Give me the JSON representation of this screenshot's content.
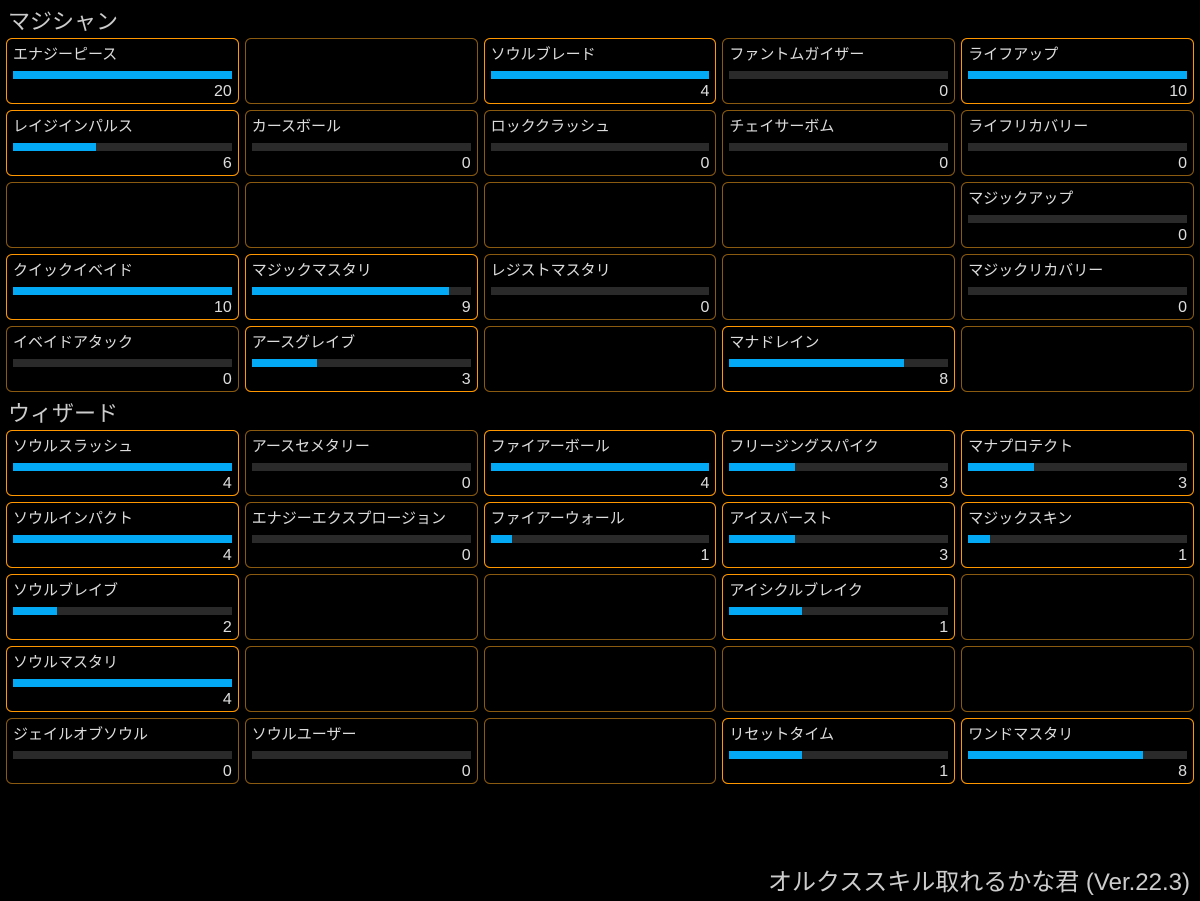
{
  "footer": "オルクススキル取れるかな君 (Ver.22.3)",
  "sections": [
    {
      "title": "マジシャン",
      "rows": [
        [
          {
            "name": "エナジーピース",
            "value": 20,
            "fill": 100,
            "bright": true
          },
          {
            "empty": true
          },
          {
            "name": "ソウルブレード",
            "value": 4,
            "fill": 100,
            "bright": true
          },
          {
            "name": "ファントムガイザー",
            "value": 0,
            "fill": 0,
            "bright": false
          },
          {
            "name": "ライフアップ",
            "value": 10,
            "fill": 100,
            "bright": true
          }
        ],
        [
          {
            "name": "レイジインパルス",
            "value": 6,
            "fill": 38,
            "bright": true
          },
          {
            "name": "カースボール",
            "value": 0,
            "fill": 0,
            "bright": false
          },
          {
            "name": "ロッククラッシュ",
            "value": 0,
            "fill": 0,
            "bright": false
          },
          {
            "name": "チェイサーボム",
            "value": 0,
            "fill": 0,
            "bright": false
          },
          {
            "name": "ライフリカバリー",
            "value": 0,
            "fill": 0,
            "bright": false
          }
        ],
        [
          {
            "empty": true
          },
          {
            "empty": true
          },
          {
            "empty": true
          },
          {
            "empty": true
          },
          {
            "name": "マジックアップ",
            "value": 0,
            "fill": 0,
            "bright": false
          }
        ],
        [
          {
            "name": "クイックイベイド",
            "value": 10,
            "fill": 100,
            "bright": true
          },
          {
            "name": "マジックマスタリ",
            "value": 9,
            "fill": 90,
            "bright": true
          },
          {
            "name": "レジストマスタリ",
            "value": 0,
            "fill": 0,
            "bright": false
          },
          {
            "empty": true
          },
          {
            "name": "マジックリカバリー",
            "value": 0,
            "fill": 0,
            "bright": false
          }
        ],
        [
          {
            "name": "イベイドアタック",
            "value": 0,
            "fill": 0,
            "bright": false
          },
          {
            "name": "アースグレイブ",
            "value": 3,
            "fill": 30,
            "bright": true
          },
          {
            "empty": true
          },
          {
            "name": "マナドレイン",
            "value": 8,
            "fill": 80,
            "bright": true
          },
          {
            "empty": true
          }
        ]
      ]
    },
    {
      "title": "ウィザード",
      "rows": [
        [
          {
            "name": "ソウルスラッシュ",
            "value": 4,
            "fill": 100,
            "bright": true
          },
          {
            "name": "アースセメタリー",
            "value": 0,
            "fill": 0,
            "bright": false
          },
          {
            "name": "ファイアーボール",
            "value": 4,
            "fill": 100,
            "bright": true
          },
          {
            "name": "フリージングスパイク",
            "value": 3,
            "fill": 30,
            "bright": true
          },
          {
            "name": "マナプロテクト",
            "value": 3,
            "fill": 30,
            "bright": true
          }
        ],
        [
          {
            "name": "ソウルインパクト",
            "value": 4,
            "fill": 100,
            "bright": true
          },
          {
            "name": "エナジーエクスプロージョン",
            "value": 0,
            "fill": 0,
            "bright": false
          },
          {
            "name": "ファイアーウォール",
            "value": 1,
            "fill": 10,
            "bright": true
          },
          {
            "name": "アイスバースト",
            "value": 3,
            "fill": 30,
            "bright": true
          },
          {
            "name": "マジックスキン",
            "value": 1,
            "fill": 10,
            "bright": true
          }
        ],
        [
          {
            "name": "ソウルブレイブ",
            "value": 2,
            "fill": 20,
            "bright": true
          },
          {
            "empty": true
          },
          {
            "empty": true
          },
          {
            "name": "アイシクルブレイク",
            "value": 1,
            "fill": 33,
            "bright": true
          },
          {
            "empty": true
          }
        ],
        [
          {
            "name": "ソウルマスタリ",
            "value": 4,
            "fill": 100,
            "bright": true
          },
          {
            "empty": true
          },
          {
            "empty": true
          },
          {
            "empty": true
          },
          {
            "empty": true
          }
        ],
        [
          {
            "name": "ジェイルオブソウル",
            "value": 0,
            "fill": 0,
            "bright": false
          },
          {
            "name": "ソウルユーザー",
            "value": 0,
            "fill": 0,
            "bright": false
          },
          {
            "empty": true
          },
          {
            "name": "リセットタイム",
            "value": 1,
            "fill": 33,
            "bright": true
          },
          {
            "name": "ワンドマスタリ",
            "value": 8,
            "fill": 80,
            "bright": true
          }
        ]
      ]
    }
  ]
}
